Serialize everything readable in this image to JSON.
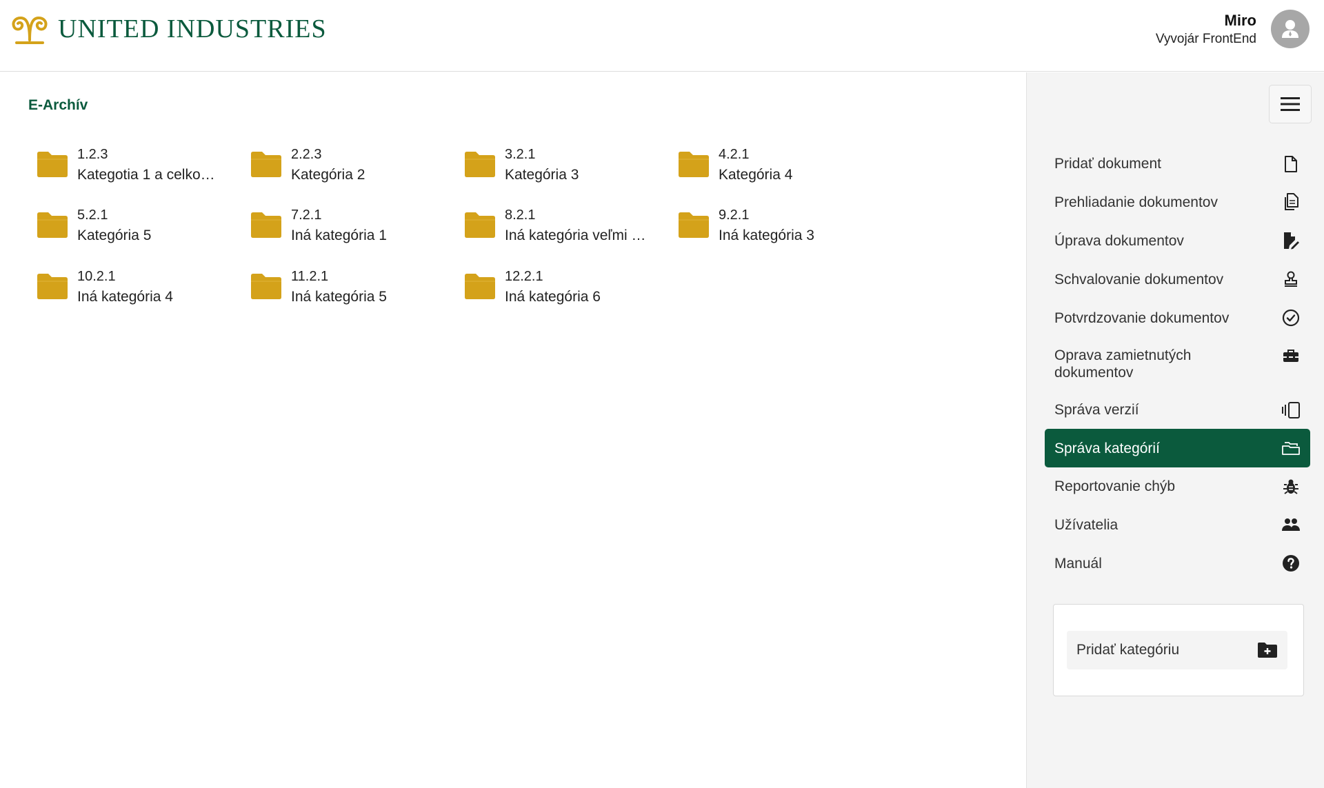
{
  "brand": {
    "name": "UNITED INDUSTRIES",
    "color_primary": "#0b5a3d",
    "color_gold": "#d4a21a"
  },
  "user": {
    "name": "Miro",
    "role": "Vyvojár FrontEnd"
  },
  "main": {
    "title": "E-Archív",
    "folders": [
      {
        "code": "1.2.3",
        "name": "Kategotia 1 a celko…"
      },
      {
        "code": "2.2.3",
        "name": "Kategória 2"
      },
      {
        "code": "3.2.1",
        "name": "Kategória 3"
      },
      {
        "code": "4.2.1",
        "name": "Kategória 4"
      },
      {
        "code": "5.2.1",
        "name": "Kategória 5"
      },
      {
        "code": "7.2.1",
        "name": "Iná kategória 1"
      },
      {
        "code": "8.2.1",
        "name": "Iná kategória veľmi …"
      },
      {
        "code": "9.2.1",
        "name": "Iná kategória 3"
      },
      {
        "code": "10.2.1",
        "name": "Iná kategória 4"
      },
      {
        "code": "11.2.1",
        "name": "Iná kategória 5"
      },
      {
        "code": "12.2.1",
        "name": "Iná kategória 6"
      }
    ]
  },
  "sidebar": {
    "menu_icon": "hamburger-icon",
    "items": [
      {
        "label": "Pridať dokument",
        "icon": "file-icon"
      },
      {
        "label": "Prehliadanie dokumentov",
        "icon": "files-icon"
      },
      {
        "label": "Úprava dokumentov",
        "icon": "file-edit-icon"
      },
      {
        "label": "Schvalovanie dokumentov",
        "icon": "stamp-icon"
      },
      {
        "label": "Potvrdzovanie dokumentov",
        "icon": "check-circle-icon"
      },
      {
        "label": "Oprava zamietnutých dokumentov",
        "icon": "toolbox-icon"
      },
      {
        "label": "Správa verzií",
        "icon": "versions-icon"
      },
      {
        "label": "Správa kategórií",
        "icon": "folders-icon",
        "active": true
      },
      {
        "label": "Reportovanie chýb",
        "icon": "bug-icon"
      },
      {
        "label": "Užívatelia",
        "icon": "users-icon"
      },
      {
        "label": "Manuál",
        "icon": "help-circle-icon"
      }
    ],
    "add_category": {
      "label": "Pridať kategóriu",
      "icon": "folder-plus-icon"
    }
  }
}
